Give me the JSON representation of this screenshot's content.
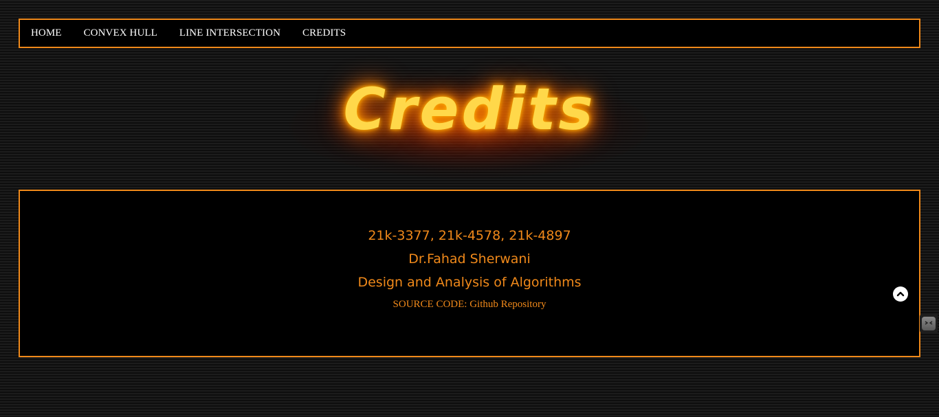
{
  "nav": {
    "items": [
      {
        "label": "HOME"
      },
      {
        "label": "CONVEX HULL"
      },
      {
        "label": "LINE INTERSECTION"
      },
      {
        "label": "CREDITS"
      }
    ]
  },
  "hero": {
    "title": "Credits"
  },
  "credits": {
    "ids": "21k-3377, 21k-4578, 21k-4897",
    "instructor": "Dr.Fahad Sherwani",
    "course": "Design and Analysis of Algorithms",
    "source_prefix": "SOURCE CODE: ",
    "source_link": "Github Repository"
  },
  "icons": {
    "scroll_top": "chevron-up-icon",
    "side_widget": "face-icon"
  },
  "colors": {
    "accent": "#f0891a",
    "title": "#ffd84a",
    "background": "#141414"
  }
}
